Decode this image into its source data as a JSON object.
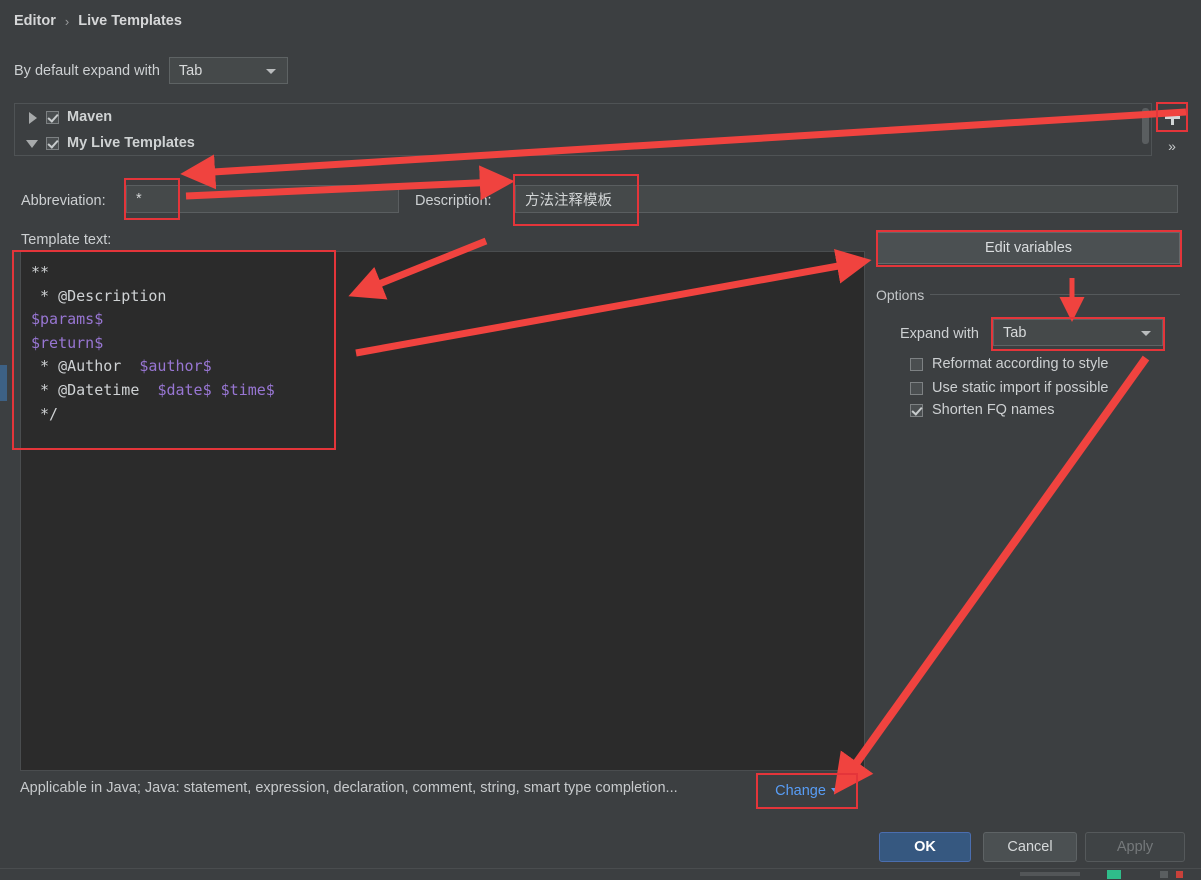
{
  "breadcrumb": {
    "root": "Editor",
    "separator": "›",
    "current": "Live Templates"
  },
  "default_expand": {
    "label": "By default expand with",
    "value": "Tab"
  },
  "tree": {
    "items": [
      {
        "label": "Maven",
        "expanded": false,
        "checked": true,
        "arrow": "triangle-right-icon"
      },
      {
        "label": "My Live Templates",
        "expanded": true,
        "checked": true,
        "arrow": "triangle-down-icon"
      }
    ]
  },
  "side_buttons": {
    "add": "+",
    "more": "»"
  },
  "abbreviation": {
    "label": "Abbreviation:",
    "value": "*"
  },
  "description": {
    "label": "Description:",
    "value": "方法注释模板"
  },
  "template_text": {
    "caption": "Template text:",
    "lines": [
      [
        {
          "t": "**",
          "c": "c-cmt"
        }
      ],
      [
        {
          "t": " * ",
          "c": "c-cmt"
        },
        {
          "t": "@Description ",
          "c": "c-cmt"
        }
      ],
      [
        {
          "t": "$params$",
          "c": "c-var"
        }
      ],
      [
        {
          "t": "$return$",
          "c": "c-var"
        }
      ],
      [
        {
          "t": " * ",
          "c": "c-cmt"
        },
        {
          "t": "@Author  ",
          "c": "c-cmt"
        },
        {
          "t": "$author$",
          "c": "c-var"
        }
      ],
      [
        {
          "t": " * ",
          "c": "c-cmt"
        },
        {
          "t": "@Datetime  ",
          "c": "c-cmt"
        },
        {
          "t": "$date$ $time$",
          "c": "c-var"
        }
      ],
      [
        {
          "t": " */",
          "c": "c-cmt"
        }
      ]
    ]
  },
  "edit_variables": {
    "label": "Edit variables"
  },
  "options": {
    "title": "Options",
    "expand_with": {
      "label": "Expand with",
      "value": "Tab"
    },
    "checkboxes": [
      {
        "label": "Reformat according to style",
        "checked": false
      },
      {
        "label": "Use static import if possible",
        "checked": false
      },
      {
        "label": "Shorten FQ names",
        "checked": true
      }
    ]
  },
  "applicable": {
    "text": "Applicable in Java; Java: statement, expression, declaration, comment, string, smart type completion...",
    "change_label": "Change"
  },
  "dialog_buttons": {
    "ok": "OK",
    "cancel": "Cancel",
    "apply": "Apply"
  },
  "colors": {
    "dialog_bg": "#3c3f41",
    "editor_bg": "#2b2b2b",
    "accent_blue": "#365880",
    "link_blue": "#589df6",
    "annotation_red": "#e4353a",
    "variable_purple": "#9876d3"
  }
}
